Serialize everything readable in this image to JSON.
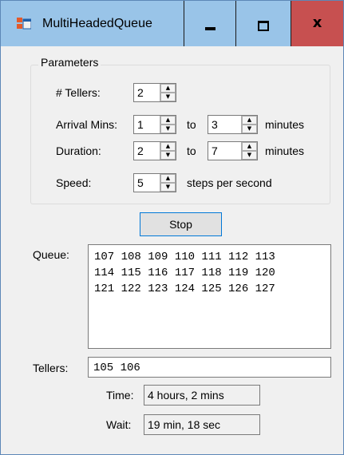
{
  "window": {
    "title": "MultiHeadedQueue",
    "close_glyph": "x",
    "icons": [
      "app-icon",
      "minimize-icon",
      "maximize-icon",
      "close-icon"
    ]
  },
  "parameters": {
    "group_title": "Parameters",
    "tellers_label": "# Tellers:",
    "tellers_value": "2",
    "arrival_label": "Arrival Mins:",
    "arrival_min": "1",
    "arrival_to": "to",
    "arrival_max": "3",
    "arrival_units": "minutes",
    "duration_label": "Duration:",
    "duration_min": "2",
    "duration_to": "to",
    "duration_max": "7",
    "duration_units": "minutes",
    "speed_label": "Speed:",
    "speed_value": "5",
    "speed_units": "steps per second",
    "spin_up_glyph": "▲",
    "spin_down_glyph": "▼"
  },
  "controls": {
    "stop_label": "Stop"
  },
  "queue": {
    "label": "Queue:",
    "lines": [
      "107 108 109 110 111 112 113",
      "114 115 116 117 118 119 120",
      "121 122 123 124 125 126 127"
    ]
  },
  "tellers": {
    "label": "Tellers:",
    "value": "105 106"
  },
  "stats": {
    "time_label": "Time:",
    "time_value": "4 hours, 2 mins",
    "wait_label": "Wait:",
    "wait_value": "19 min, 18 sec"
  },
  "colors": {
    "titlebar": "#99c4e8",
    "close_button": "#c75050",
    "window_bg": "#f0f0f0",
    "button_focus_border": "#0078d7"
  }
}
